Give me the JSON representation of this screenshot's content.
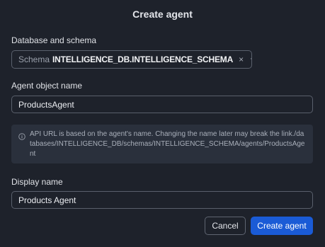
{
  "dialog": {
    "title": "Create agent"
  },
  "database_schema": {
    "label": "Database and schema",
    "prefix": "Schema",
    "value": "INTELLIGENCE_DB.INTELLIGENCE_SCHEMA",
    "clear_glyph": "×"
  },
  "agent_object_name": {
    "label": "Agent object name",
    "value": "ProductsAgent"
  },
  "info": {
    "icon": "info-circle-icon",
    "text": "API URL is based on the agent's name. Changing the name later may break the link./databases/INTELLIGENCE_DB/schemas/INTELLIGENCE_SCHEMA/agents/ProductsAgent"
  },
  "display_name": {
    "label": "Display name",
    "value": "Products Agent"
  },
  "buttons": {
    "cancel": "Cancel",
    "create": "Create agent"
  },
  "colors": {
    "background": "#1e222b",
    "primary": "#1a5bd6",
    "info_background": "#2a303c"
  }
}
